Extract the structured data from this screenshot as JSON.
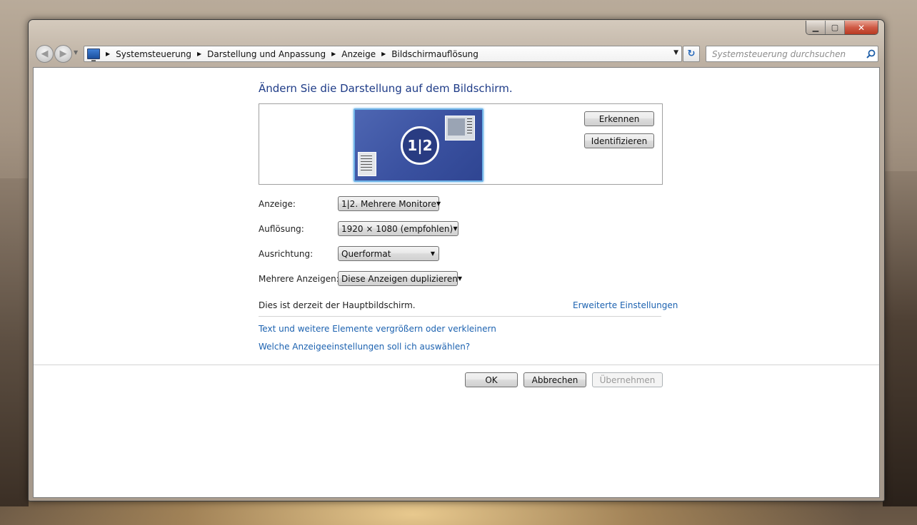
{
  "window": {
    "caption_buttons": {
      "minimize": "▁",
      "maximize": "▢",
      "close": "✕"
    }
  },
  "nav": {
    "back": "◀",
    "forward": "▶",
    "dropdown": "▼",
    "breadcrumb": [
      "Systemsteuerung",
      "Darstellung und Anpassung",
      "Anzeige",
      "Bildschirmauflösung"
    ],
    "address_dropdown": "▼",
    "refresh": "↻",
    "search_placeholder": "Systemsteuerung durchsuchen",
    "search_icon": "⚲"
  },
  "main": {
    "title": "Ändern Sie die Darstellung auf dem Bildschirm.",
    "monitor_badge": "1|2",
    "detect_label": "Erkennen",
    "identify_label": "Identifizieren",
    "fields": {
      "display_label": "Anzeige:",
      "display_value": "1|2. Mehrere Monitore",
      "resolution_label": "Auflösung:",
      "resolution_value": "1920 × 1080 (empfohlen)",
      "orientation_label": "Ausrichtung:",
      "orientation_value": "Querformat",
      "multiple_label": "Mehrere Anzeigen:",
      "multiple_value": "Diese Anzeigen duplizieren"
    },
    "status": "Dies ist derzeit der Hauptbildschirm.",
    "advanced_link": "Erweiterte Einstellungen",
    "text_size_link": "Text und weitere Elemente vergrößern oder verkleinern",
    "help_link": "Welche Anzeigeeinstellungen soll ich auswählen?"
  },
  "footer": {
    "ok": "OK",
    "cancel": "Abbrechen",
    "apply": "Übernehmen"
  }
}
